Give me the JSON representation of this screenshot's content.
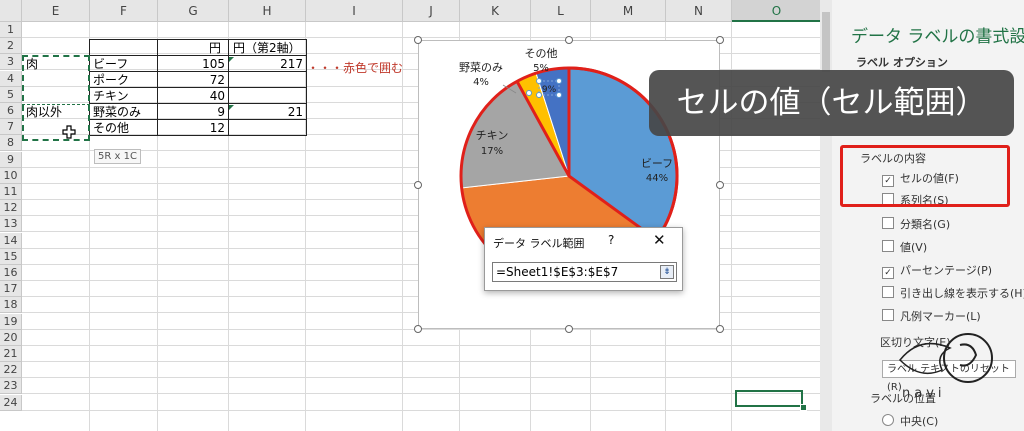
{
  "spreadsheet": {
    "columns": [
      "E",
      "F",
      "G",
      "H",
      "I",
      "J",
      "K",
      "L",
      "M",
      "N",
      "O"
    ],
    "selected_column": "O",
    "rows": [
      "1",
      "2",
      "3",
      "4",
      "5",
      "6",
      "7",
      "8",
      "9",
      "10",
      "11",
      "12",
      "13",
      "14",
      "15",
      "16",
      "17",
      "18",
      "19",
      "20",
      "21",
      "22",
      "23",
      "24"
    ],
    "header_row": {
      "g": "円",
      "h": "円（第2軸）"
    },
    "data_rows": [
      {
        "e": "肉",
        "f": "ビーフ",
        "g": "105",
        "h": "217"
      },
      {
        "e": "",
        "f": "ポーク",
        "g": "72",
        "h": ""
      },
      {
        "e": "",
        "f": "チキン",
        "g": "40",
        "h": ""
      },
      {
        "e": "肉以外",
        "f": "野菜のみ",
        "g": "9",
        "h": "21"
      },
      {
        "e": "",
        "f": "その他",
        "g": "12",
        "h": ""
      }
    ],
    "annotation": "・・・赤色で囲む",
    "selection_tooltip": "5R x 1C",
    "accent_color": "#217346"
  },
  "chart": {
    "slices": [
      {
        "label": "ビーフ",
        "percent": "44%",
        "color": "#5b9bd5"
      },
      {
        "label": "ポーク",
        "percent": "",
        "color": "#ed7d31"
      },
      {
        "label": "チキン",
        "percent": "17%",
        "color": "#a5a5a5"
      },
      {
        "label": "野菜のみ",
        "percent": "4%",
        "color": "#ffc000"
      },
      {
        "label": "その他",
        "percent": "5%",
        "color": "#4472c4"
      }
    ],
    "selected_label_value": "9%",
    "outline_color": "#e0201a"
  },
  "dialog": {
    "title": "データ ラベル範囲",
    "help": "?",
    "close": "✕",
    "input_value": "=Sheet1!$E$3:$E$7",
    "collapse_icon": "⇟"
  },
  "caption": "セルの値（セル範囲）",
  "format_pane": {
    "title": "データ ラベルの書式設定",
    "tab": "ラベル オプション",
    "section": "ラベルの内容",
    "options": [
      {
        "label": "セルの値(F)",
        "checked": true
      },
      {
        "label": "系列名(S)",
        "checked": false
      },
      {
        "label": "分類名(G)",
        "checked": false
      },
      {
        "label": "値(V)",
        "checked": false
      },
      {
        "label": "パーセンテージ(P)",
        "checked": true
      },
      {
        "label": "引き出し線を表示する(H)",
        "checked": false
      },
      {
        "label": "凡例マーカー(L)",
        "checked": false
      }
    ],
    "separator_label": "区切り文字(E)",
    "reset_button": "ラベル テキストのリセット(R)",
    "position_label": "ラベルの位置",
    "position_option": "中央(C)",
    "logo_text": "navi"
  }
}
